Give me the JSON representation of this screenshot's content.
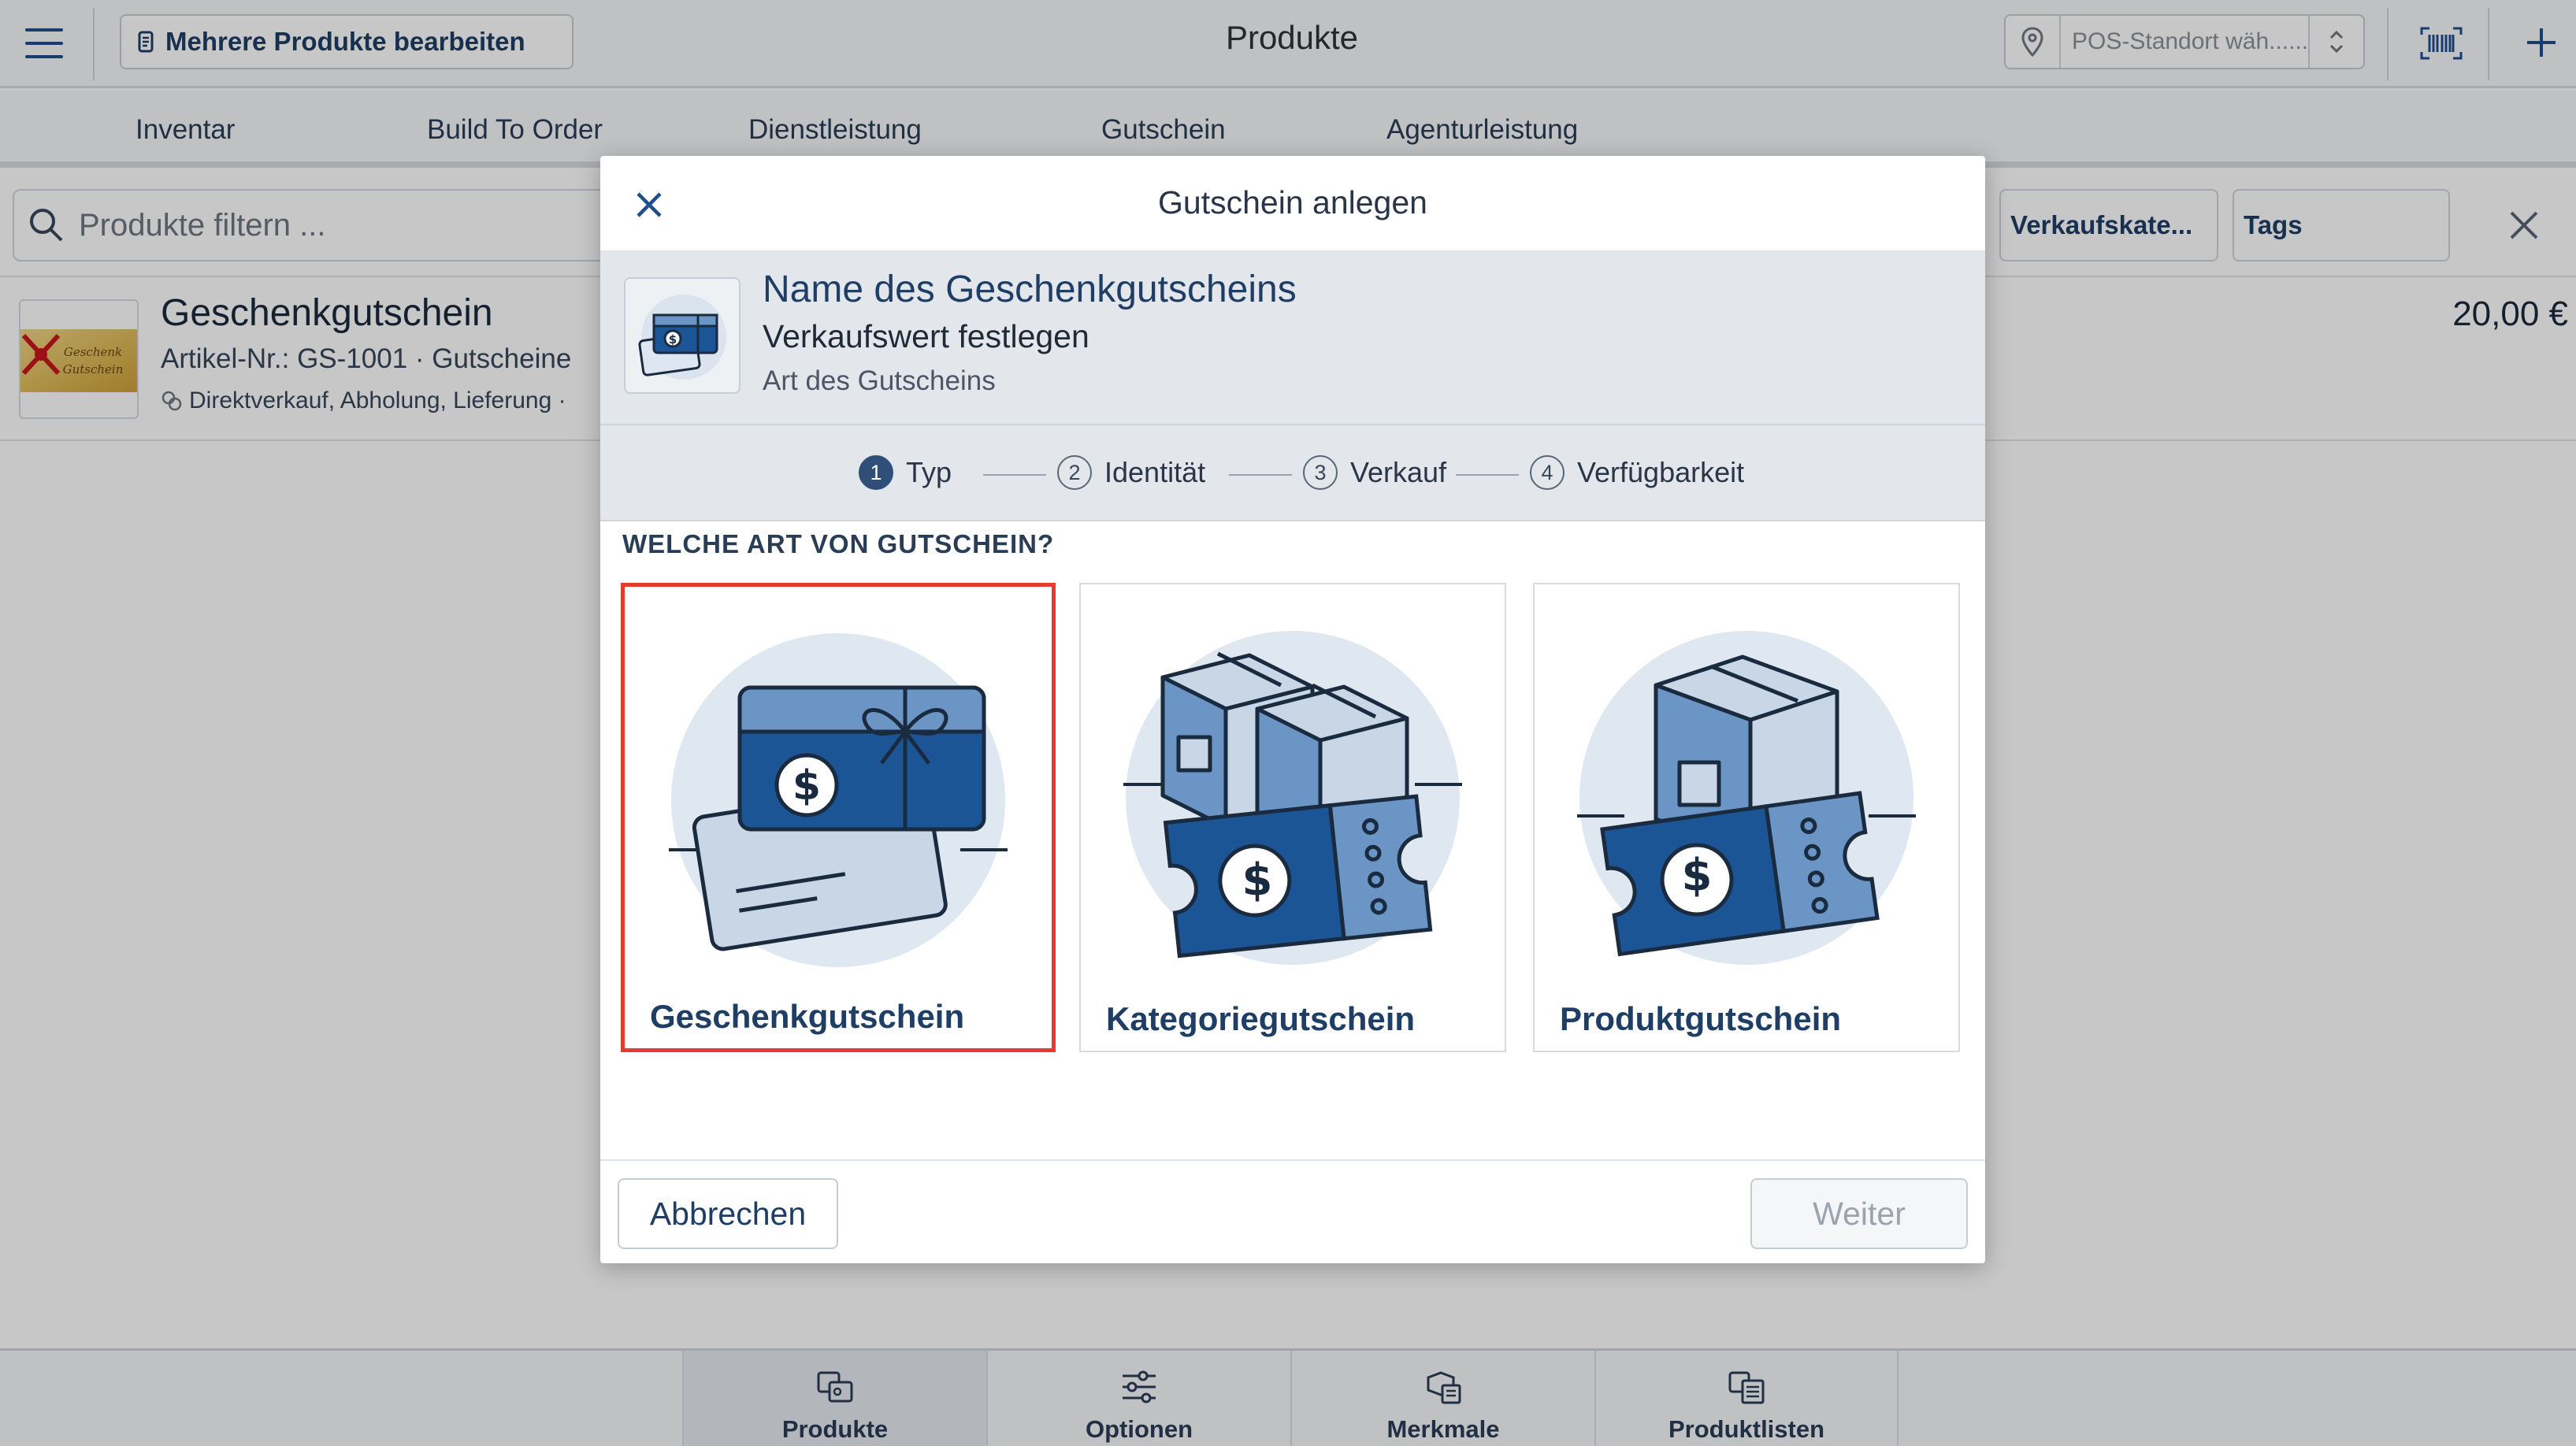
{
  "header": {
    "bulk_edit_label": "Mehrere Produkte bearbeiten",
    "page_title": "Produkte",
    "pos_placeholder": "POS-Standort wäh......"
  },
  "tabs": [
    {
      "label": "Inventar"
    },
    {
      "label": "Build To Order"
    },
    {
      "label": "Dienstleistung"
    },
    {
      "label": "Gutschein"
    },
    {
      "label": "Agenturleistung"
    }
  ],
  "filter": {
    "search_placeholder": "Produkte filtern ...",
    "chips": [
      {
        "label": "Verkaufskate..."
      },
      {
        "label": "Tags"
      }
    ]
  },
  "product": {
    "name": "Geschenkgutschein",
    "subtitle": "Artikel-Nr.: GS-1001 · Gutscheine",
    "tags": "Direktverkauf, Abholung, Lieferung ·",
    "price": "20,00 €",
    "thumb_text": "Geschenk Gutschein"
  },
  "bottom_nav": [
    {
      "label": "Produkte",
      "icon": "products-icon",
      "active": true
    },
    {
      "label": "Optionen",
      "icon": "sliders-icon",
      "active": false
    },
    {
      "label": "Merkmale",
      "icon": "attributes-icon",
      "active": false
    },
    {
      "label": "Produktlisten",
      "icon": "product-lists-icon",
      "active": false
    }
  ],
  "modal": {
    "title": "Gutschein anlegen",
    "summary": {
      "title": "Name des Geschenkgutscheins",
      "line2": "Verkaufswert festlegen",
      "line3": "Art des Gutscheins"
    },
    "steps": [
      {
        "num": "1",
        "label": "Typ",
        "active": true
      },
      {
        "num": "2",
        "label": "Identität",
        "active": false
      },
      {
        "num": "3",
        "label": "Verkauf",
        "active": false
      },
      {
        "num": "4",
        "label": "Verfügbarkeit",
        "active": false
      }
    ],
    "question": "WELCHE ART VON GUTSCHEIN?",
    "options": [
      {
        "label": "Geschenkgutschein",
        "selected": true
      },
      {
        "label": "Kategoriegutschein",
        "selected": false
      },
      {
        "label": "Produktgutschein",
        "selected": false
      }
    ],
    "cancel_label": "Abbrechen",
    "next_label": "Weiter"
  },
  "colors": {
    "brand_blue": "#1f4e8c",
    "selection_red": "#e53a2f",
    "illustration_dark": "#1c5596",
    "illustration_mid": "#6b95c4",
    "illustration_light": "#c9d6e6"
  }
}
